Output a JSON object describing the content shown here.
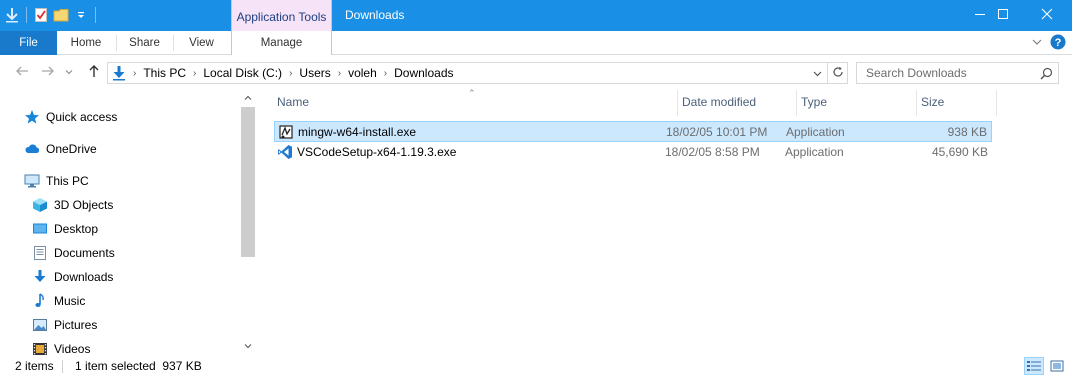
{
  "titlebar": {
    "context_tab_group": "Application Tools",
    "window_title": "Downloads",
    "minimize_icon": "minimize-icon",
    "maximize_icon": "maximize-icon",
    "close_icon": "close-icon"
  },
  "ribbon": {
    "tabs": [
      {
        "label": "File"
      },
      {
        "label": "Home"
      },
      {
        "label": "Share"
      },
      {
        "label": "View"
      },
      {
        "label": "Manage"
      }
    ]
  },
  "address": {
    "breadcrumbs": [
      "This PC",
      "Local Disk (C:)",
      "Users",
      "voleh",
      "Downloads"
    ]
  },
  "search": {
    "placeholder": "Search Downloads"
  },
  "navpane": {
    "items": [
      {
        "label": "Quick access",
        "icon": "star-icon"
      },
      {
        "label": "OneDrive",
        "icon": "cloud-icon"
      },
      {
        "label": "This PC",
        "icon": "computer-icon"
      },
      {
        "label": "3D Objects",
        "icon": "cube-icon"
      },
      {
        "label": "Desktop",
        "icon": "desktop-icon"
      },
      {
        "label": "Documents",
        "icon": "document-icon"
      },
      {
        "label": "Downloads",
        "icon": "download-arrow-icon"
      },
      {
        "label": "Music",
        "icon": "music-note-icon"
      },
      {
        "label": "Pictures",
        "icon": "picture-icon"
      },
      {
        "label": "Videos",
        "icon": "film-icon"
      }
    ]
  },
  "filelist": {
    "columns": [
      "Name",
      "Date modified",
      "Type",
      "Size"
    ],
    "rows": [
      {
        "name": "mingw-w64-install.exe",
        "date": "18/02/05 10:01 PM",
        "type": "Application",
        "size": "938 KB",
        "selected": true
      },
      {
        "name": "VSCodeSetup-x64-1.19.3.exe",
        "date": "18/02/05 8:58 PM",
        "type": "Application",
        "size": "45,690 KB",
        "selected": false
      }
    ]
  },
  "status": {
    "count": "2 items",
    "selection": "1 item selected  937 KB"
  },
  "colors": {
    "titlebar": "#1a8fe6",
    "file_tab": "#1979ca",
    "context_tab": "#f6e3f8",
    "selection": "#cce8ff"
  }
}
